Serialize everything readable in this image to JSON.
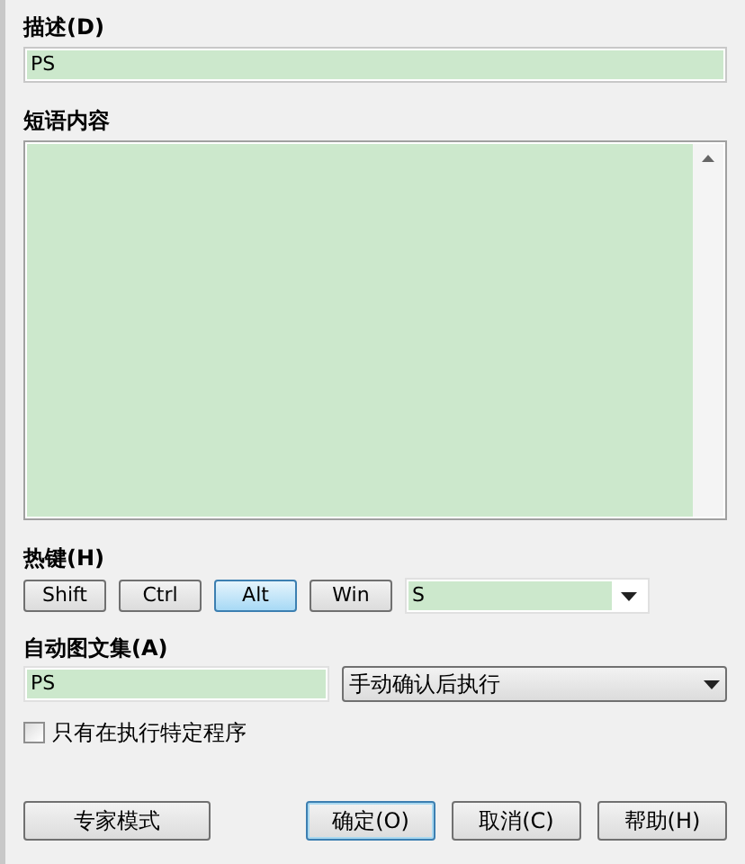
{
  "description": {
    "label": "描述(D)",
    "value": "PS"
  },
  "phrase": {
    "label": "短语内容"
  },
  "hotkey": {
    "label": "热键(H)",
    "modifiers": [
      {
        "label": "Shift",
        "selected": false
      },
      {
        "label": "Ctrl",
        "selected": false
      },
      {
        "label": "Alt",
        "selected": true
      },
      {
        "label": "Win",
        "selected": false
      }
    ],
    "key": "S"
  },
  "autotext": {
    "label": "自动图文集(A)",
    "value": "PS",
    "mode": "手动确认后执行"
  },
  "only_program": {
    "label": "只有在执行特定程序",
    "checked": false
  },
  "buttons": [
    {
      "label": "专家模式",
      "kind": "left"
    },
    {
      "label": "确定(O)",
      "kind": "default"
    },
    {
      "label": "取消(C)",
      "kind": "normal"
    },
    {
      "label": "帮助(H)",
      "kind": "normal"
    }
  ]
}
